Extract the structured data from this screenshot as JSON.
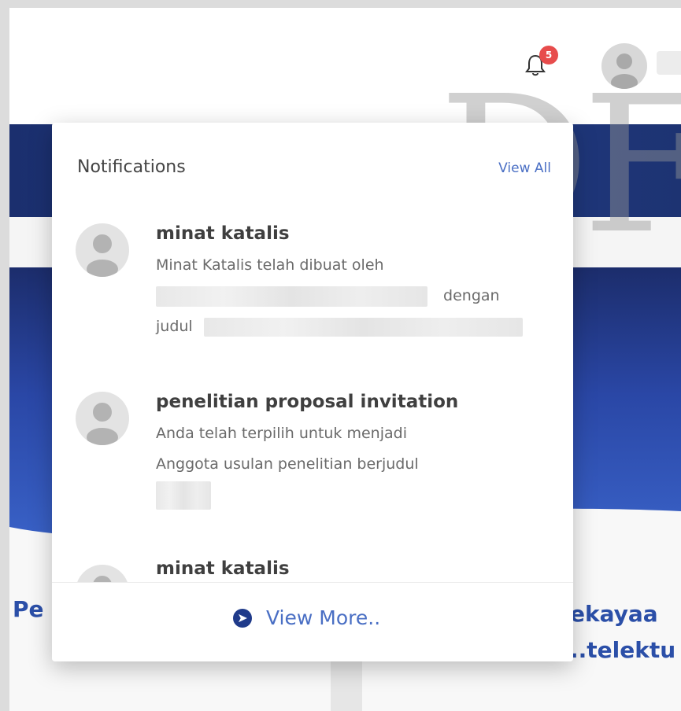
{
  "header": {
    "notification_count": "5"
  },
  "watermark": "DF",
  "background": {
    "left_heading_fragment": "Pe",
    "right_heading_line1": "ekayaa",
    "right_heading_line2": "..telektu"
  },
  "notifications": {
    "title": "Notifications",
    "view_all_label": "View All",
    "view_more_label": "View More..",
    "items": [
      {
        "title": "minat katalis",
        "body_line1": "Minat Katalis telah dibuat oleh",
        "body_line2_end": "dengan",
        "body_line3_start": "judul"
      },
      {
        "title": "penelitian proposal invitation",
        "body_line1": "Anda telah terpilih untuk menjadi",
        "body_line2": "Anggota usulan penelitian berjudul"
      },
      {
        "title": "minat katalis"
      }
    ]
  },
  "colors": {
    "accent": "#4a6fc4",
    "nav_band": "#1b2f6e",
    "badge": "#e74c4c"
  }
}
